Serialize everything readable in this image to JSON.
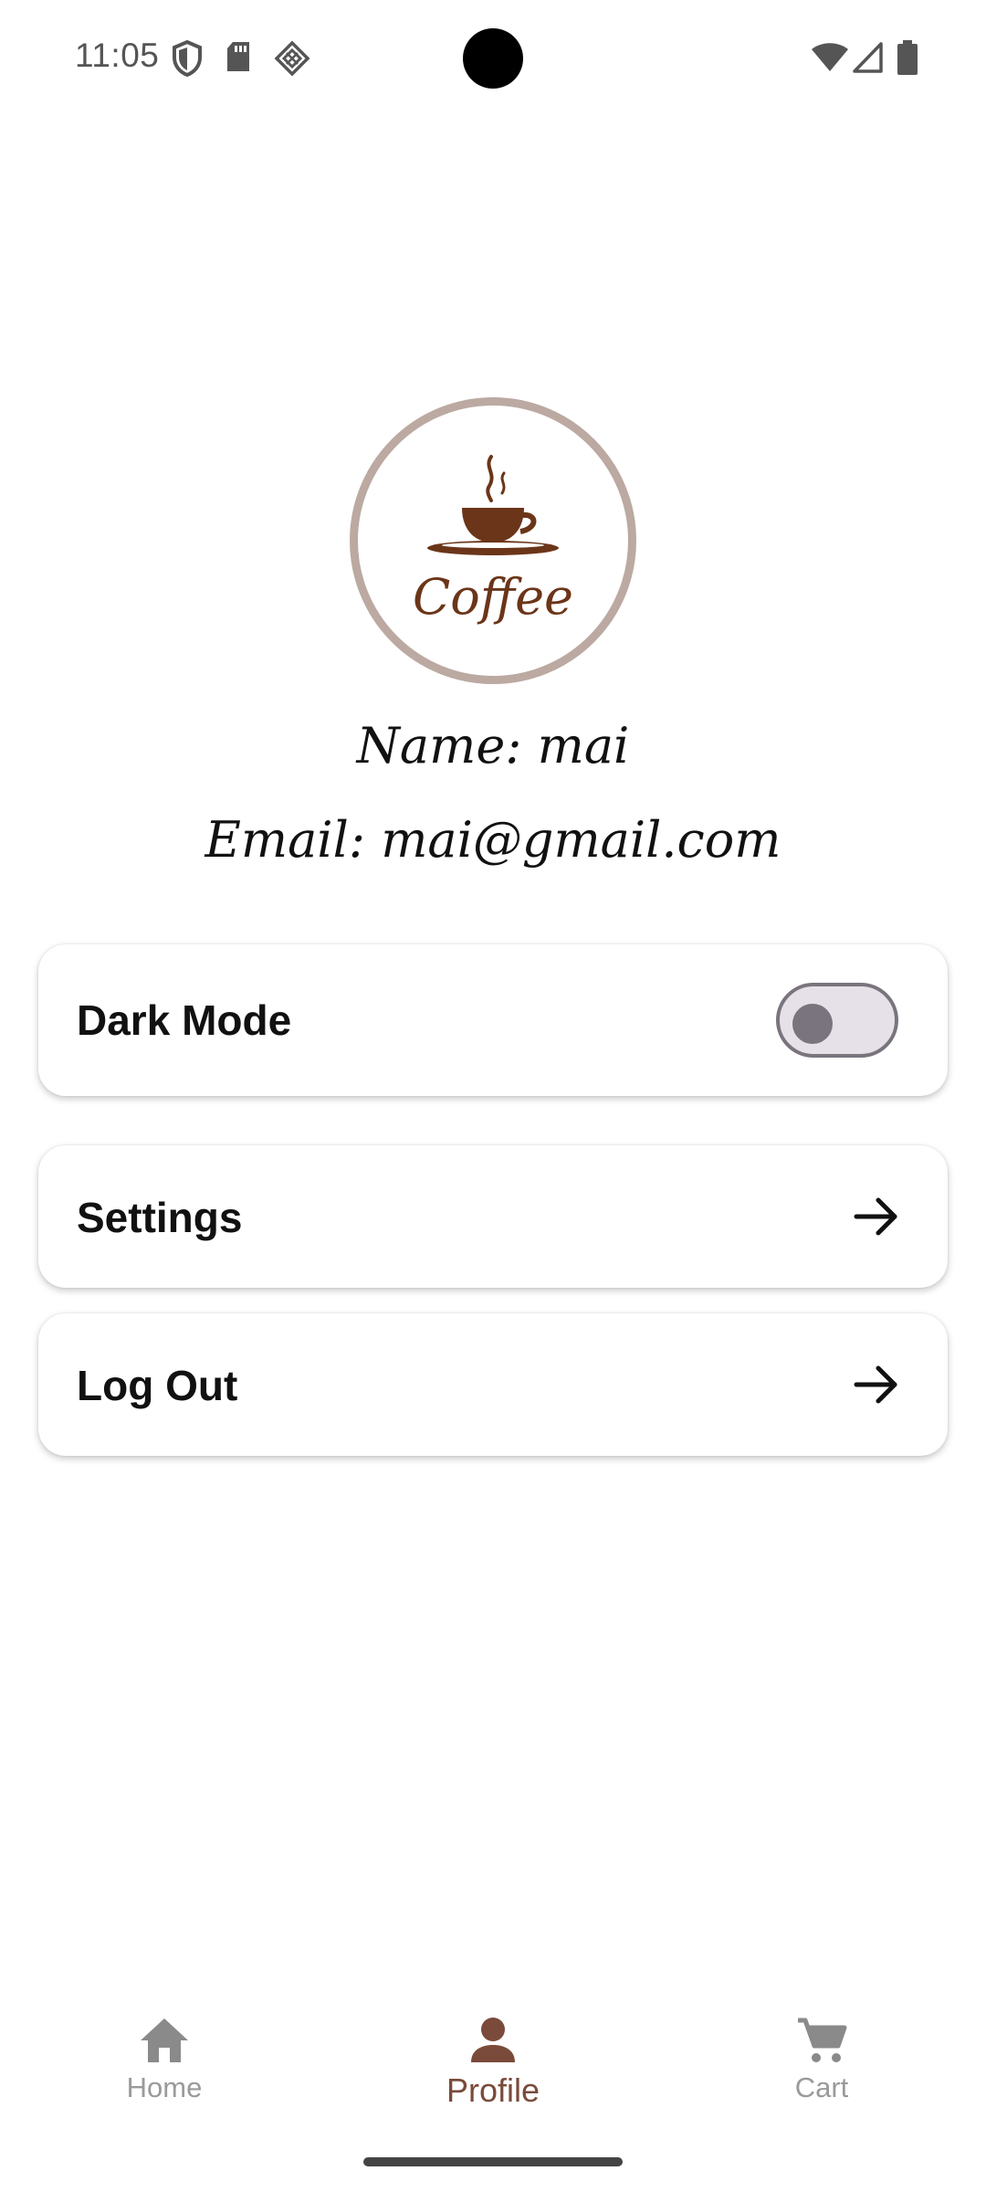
{
  "status_bar": {
    "time": "11:05",
    "left_icons": [
      "shield-icon",
      "sd-card-icon",
      "cast-icon"
    ],
    "right_icons": [
      "wifi-icon",
      "signal-icon",
      "battery-icon"
    ]
  },
  "profile": {
    "logo_text": "Coffee",
    "name_line": "Name: mai",
    "email_line": "Email: mai@gmail.com"
  },
  "settings_list": {
    "dark_mode": {
      "label": "Dark Mode",
      "enabled": false
    },
    "settings": {
      "label": "Settings",
      "icon": "arrow-right-icon"
    },
    "logout": {
      "label": "Log Out",
      "icon": "arrow-right-icon"
    }
  },
  "bottom_nav": {
    "items": [
      {
        "label": "Home",
        "icon": "home-icon",
        "selected": false
      },
      {
        "label": "Profile",
        "icon": "person-icon",
        "selected": true
      },
      {
        "label": "Cart",
        "icon": "cart-icon",
        "selected": false
      }
    ]
  },
  "colors": {
    "accent": "#7a4a3a",
    "coffee": "#6b3519",
    "avatar_ring": "#bba9a2",
    "inactive_nav": "#9a9a9a",
    "toggle_outline": "#79747e",
    "toggle_track": "#e6e0e9"
  }
}
